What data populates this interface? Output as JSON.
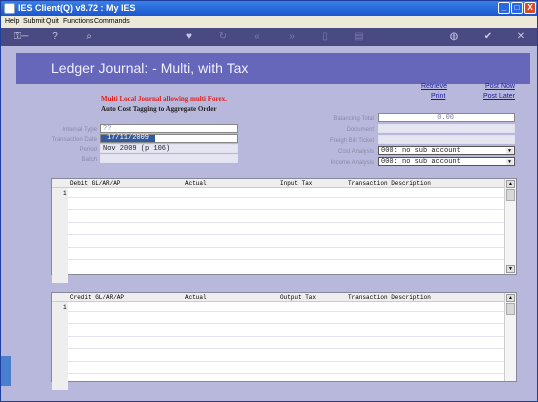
{
  "window": {
    "title": "IES Client(Q) v8.72 : My IES",
    "controls": [
      "_",
      "□",
      "X"
    ]
  },
  "menu": {
    "items": [
      "Help",
      "Submit",
      "Quit",
      "Functions",
      "Commands"
    ]
  },
  "toolbar": {
    "icons": [
      "key-icon",
      "help-icon",
      "search-icon",
      "heart-icon",
      "refresh-icon",
      "rewind-icon",
      "fast-forward-icon",
      "trash-icon",
      "page-icon",
      "globe-icon",
      "ok-icon",
      "cancel-icon"
    ]
  },
  "banner": {
    "title": "Ledger Journal: - Multi, with Tax"
  },
  "actions": {
    "retrieve": "Retrieve",
    "print": "Print",
    "post_now": "Post Now",
    "post_later": "Post Later"
  },
  "notes": {
    "warning": "Multi Local Journal allowing multi Forex.",
    "auto_tag": "Auto Cost Tagging to Aggregate Order"
  },
  "form_left": {
    "internal_type_label": "Internal Type",
    "internal_type_value": "??",
    "transaction_date_label": "Transaction Date",
    "transaction_date_value": "17/11/2009",
    "period_label": "Period",
    "period_value": "Nov 2009 (p 106)",
    "batch_label": "Batch",
    "batch_value": ""
  },
  "form_right": {
    "balancing_total_label": "Balancing Total",
    "balancing_total_value": "0.00",
    "document_label": "Document",
    "document_value": "",
    "freight_bill_label": "Freigh Bill Ticket",
    "freight_bill_value": "",
    "cost_analysis_label": "Cost Analysis",
    "cost_analysis_value": "000: no sub account",
    "income_analysis_label": "Income Analysis",
    "income_analysis_value": "000: no sub account"
  },
  "debit_grid": {
    "columns": [
      "Debit GL/AR/AP",
      "Actual",
      "Input Tax",
      "Transaction Description"
    ],
    "row_number": "1"
  },
  "credit_grid": {
    "columns": [
      "Credit GL/AR/AP",
      "Actual",
      "Output Tax",
      "Transaction Description"
    ],
    "row_number": "1"
  },
  "scrollbar": {
    "up": "▲",
    "down": "▼"
  }
}
